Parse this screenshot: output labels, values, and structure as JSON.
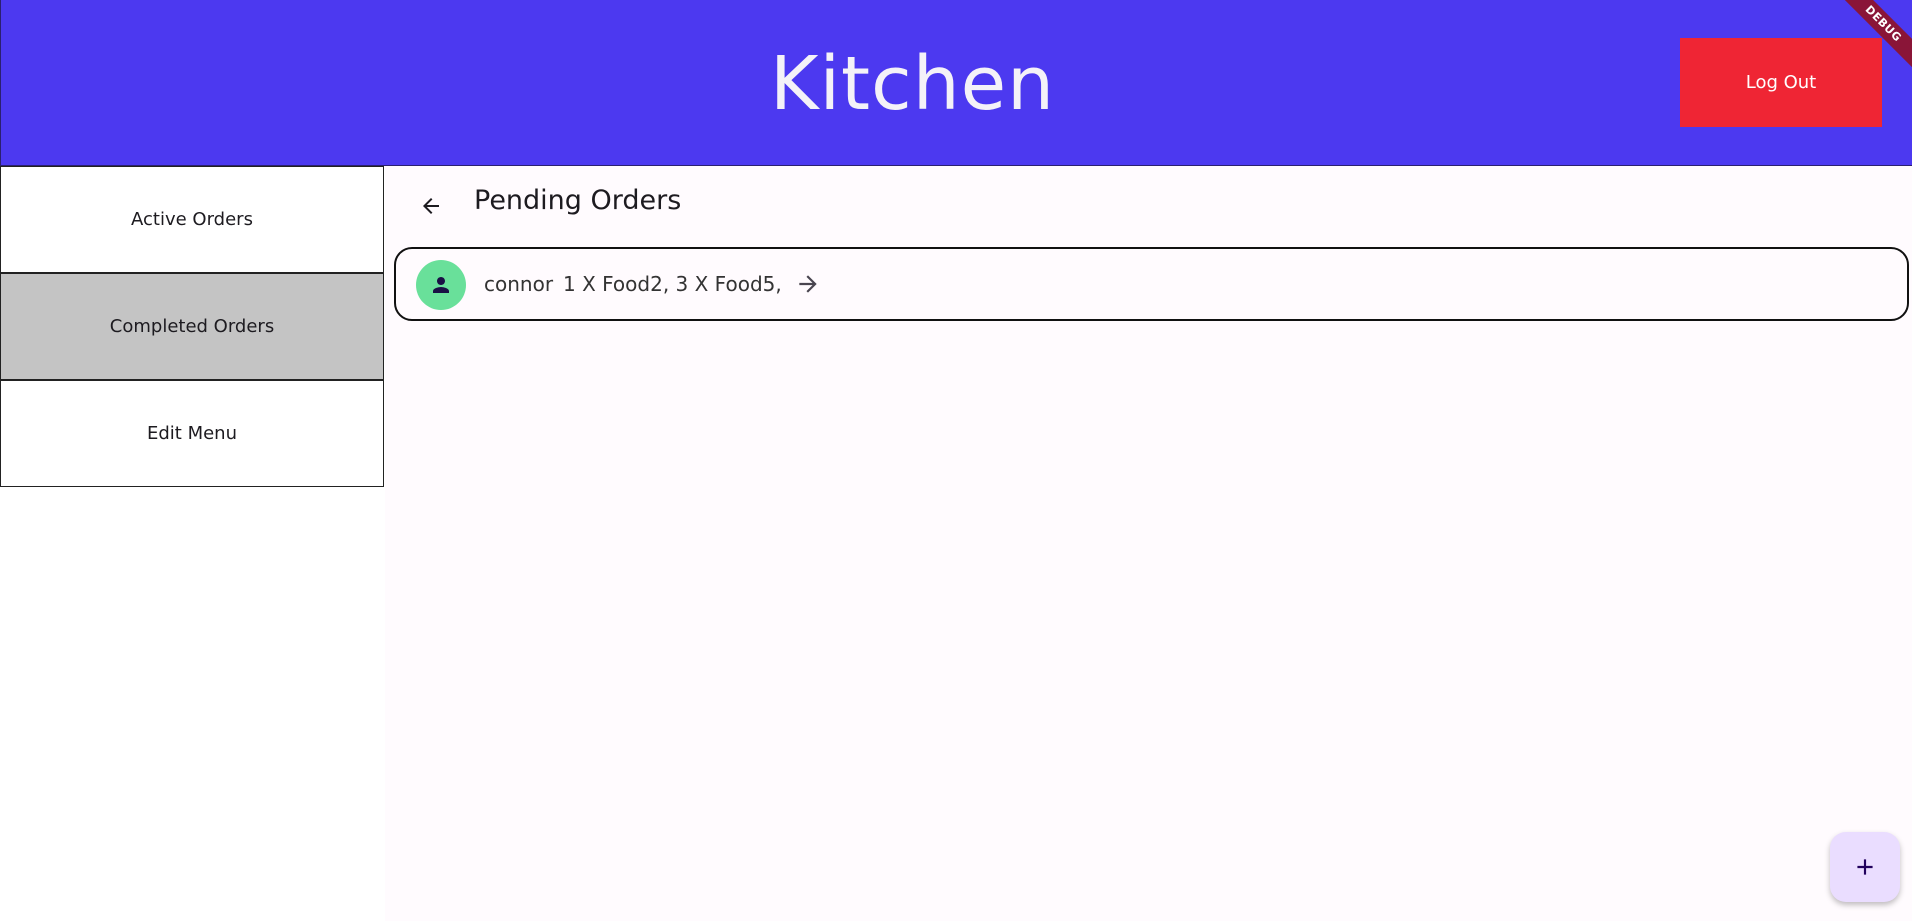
{
  "header": {
    "title": "Kitchen",
    "logout_label": "Log Out",
    "debug_label": "DEBUG"
  },
  "sidebar": {
    "items": [
      {
        "label": "Active Orders",
        "selected": false
      },
      {
        "label": "Completed Orders",
        "selected": true
      },
      {
        "label": "Edit Menu",
        "selected": false
      }
    ]
  },
  "main": {
    "title": "Pending Orders",
    "orders": [
      {
        "customer": "connor",
        "items": "1 X Food2, 3 X Food5,"
      }
    ]
  },
  "icons": {
    "back": "arrow-back-icon",
    "forward": "arrow-forward-icon",
    "avatar": "person-icon",
    "fab": "add-icon"
  },
  "colors": {
    "header_bg": "#4c39f0",
    "logout_bg": "#ef2534",
    "selected_item_bg": "#c4c4c4",
    "avatar_bg": "#69e09a",
    "fab_bg": "#eaddff"
  }
}
